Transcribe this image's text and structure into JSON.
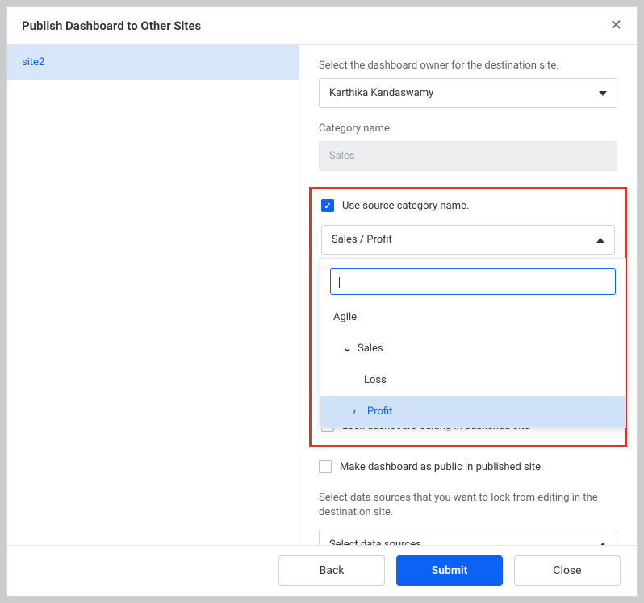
{
  "header": {
    "title": "Publish Dashboard to Other Sites"
  },
  "sidebar": {
    "items": [
      "site2"
    ]
  },
  "main": {
    "owner_label": "Select the dashboard owner for the destination site.",
    "owner_value": "Karthika Kandaswamy",
    "category_label": "Category name",
    "category_value": "Sales",
    "use_source_label": "Use source category name.",
    "category_select_value": "Sales / Profit",
    "tree": {
      "item_agile": "Agile",
      "item_sales": "Sales",
      "item_loss": "Loss",
      "item_profit": "Profit"
    },
    "lock_dashboard_label": "Lock dashboard editing in published site",
    "make_public_label": "Make dashboard as public in published site.",
    "datasource_hint": "Select data sources that you want to lock from editing in the destination site.",
    "datasource_value": "Select data sources"
  },
  "footer": {
    "back": "Back",
    "submit": "Submit",
    "close": "Close"
  }
}
